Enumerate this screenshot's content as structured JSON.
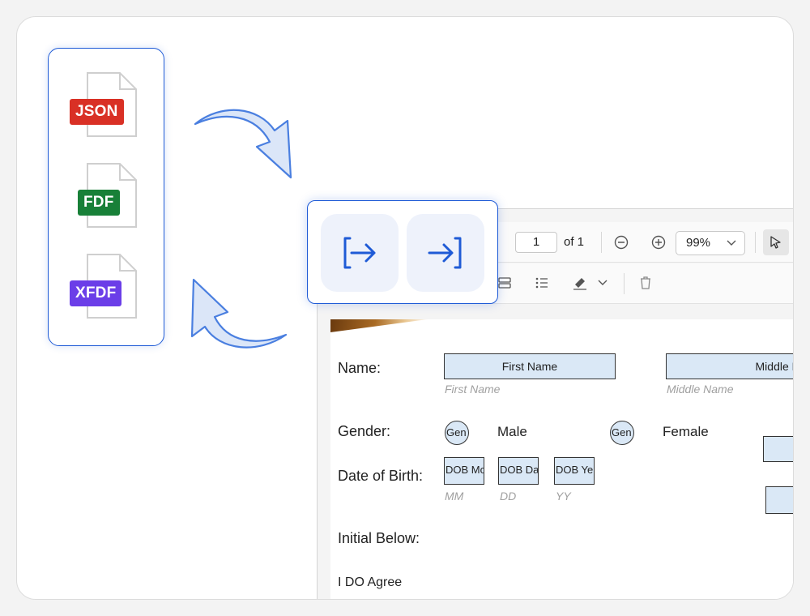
{
  "formats": {
    "items": [
      {
        "label": "JSON",
        "color": "#d93025"
      },
      {
        "label": "FDF",
        "color": "#188038"
      },
      {
        "label": "XFDF",
        "color": "#6b3ee8"
      }
    ]
  },
  "actions": {
    "import_icon": "import-icon",
    "export_icon": "export-icon"
  },
  "viewer": {
    "toolbar": {
      "page_current": "1",
      "page_total_text": "of 1",
      "zoom": "99%"
    },
    "form": {
      "name_label": "Name:",
      "first_name_field": "First Name",
      "first_name_hint": "First Name",
      "middle_name_field": "Middle Name",
      "middle_name_hint": "Middle Name",
      "gender_label": "Gender:",
      "gender_radio_1": "Gen",
      "male_label": "Male",
      "gender_radio_2": "Gen",
      "female_label": "Female",
      "dob_label": "Date of Birth:",
      "dob_month_field": "DOB Mo",
      "dob_day_field": "DOB Da",
      "dob_year_field": "DOB Ye",
      "dob_month_hint": "MM",
      "dob_day_hint": "DD",
      "dob_year_hint": "YY",
      "initial_label": "Initial Below:",
      "agree_label": "I DO Agree"
    }
  },
  "colors": {
    "accent": "#1f5bd6",
    "field_fill": "#dae8f6",
    "arrow_fill": "#dbe6f8"
  }
}
